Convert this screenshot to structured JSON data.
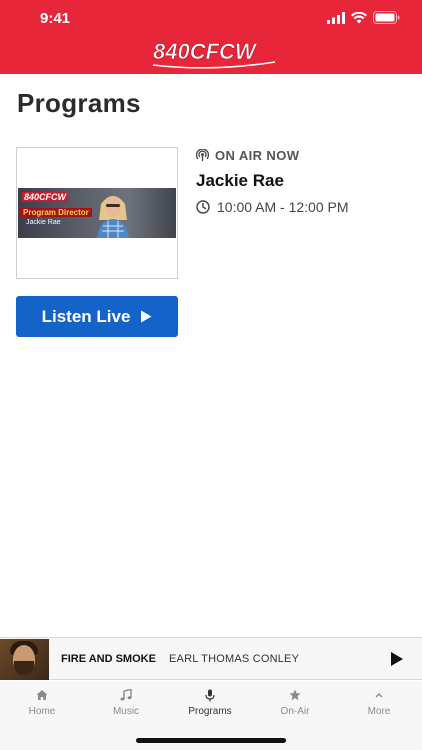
{
  "status_bar": {
    "time": "9:41"
  },
  "header": {
    "logo_text": "840CFCW",
    "background_color": "#e8263a"
  },
  "page": {
    "title": "Programs"
  },
  "program": {
    "thumbnail": {
      "logo": "840CFCW",
      "title": "Program Director",
      "name": "Jackie Rae"
    },
    "on_air_label": "ON AIR NOW",
    "host": "Jackie Rae",
    "time": "10:00 AM - 12:00 PM",
    "listen_label": "Listen Live",
    "accent_color": "#1463c9"
  },
  "now_playing": {
    "song": "FIRE AND SMOKE",
    "artist": "EARL THOMAS CONLEY"
  },
  "tabs": [
    {
      "label": "Home",
      "icon": "home-icon"
    },
    {
      "label": "Music",
      "icon": "music-icon"
    },
    {
      "label": "Programs",
      "icon": "microphone-icon",
      "active": true
    },
    {
      "label": "On-Air",
      "icon": "star-icon"
    },
    {
      "label": "More",
      "icon": "chevron-up-icon"
    }
  ]
}
